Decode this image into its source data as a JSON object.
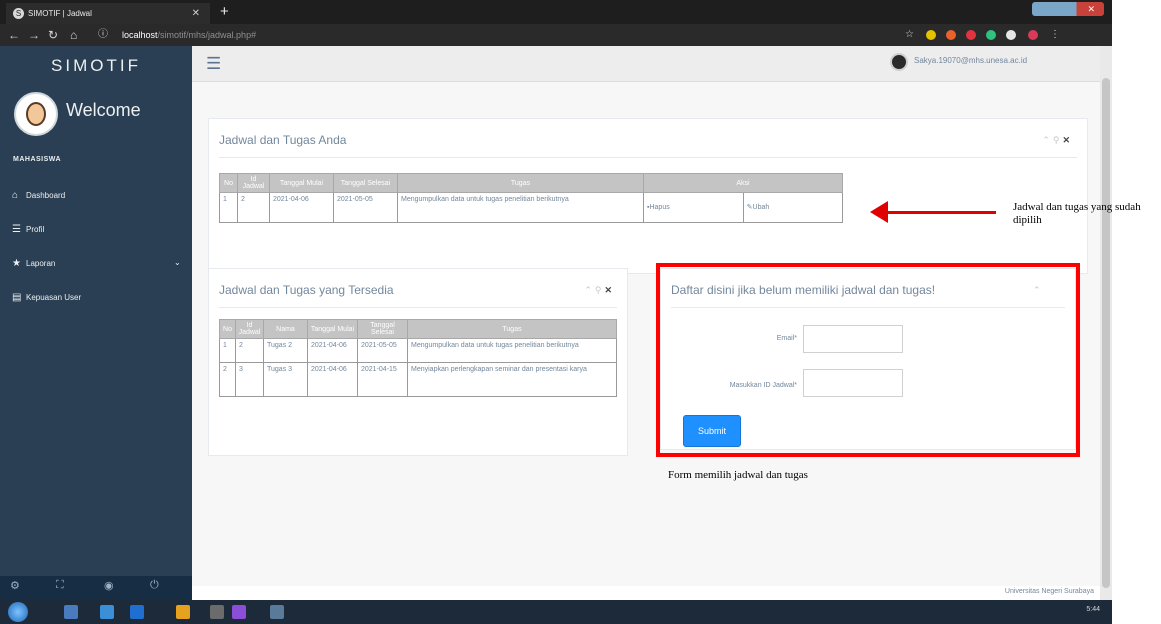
{
  "browser": {
    "tab_title": "SIMOTIF | Jadwal",
    "url_host": "localhost",
    "url_path": "/simotif/mhs/jadwal.php#"
  },
  "sidebar": {
    "brand": "SIMOTIF",
    "welcome": "Welcome",
    "username": "MAHASISWA",
    "items": [
      {
        "label": "Dashboard",
        "icon": "home-icon"
      },
      {
        "label": "Profil",
        "icon": "list-icon"
      },
      {
        "label": "Laporan",
        "icon": "star-icon"
      },
      {
        "label": "Kepuasan User",
        "icon": "table-icon"
      }
    ]
  },
  "topnav": {
    "user_email": "Sakya.19070@mhs.unesa.ac.id"
  },
  "panel_jadwal_anda": {
    "title": "Jadwal dan Tugas Anda",
    "headers": [
      "No",
      "Id Jadwal",
      "Tanggal Mulai",
      "Tanggal Selesai",
      "Tugas",
      "Aksi"
    ],
    "rows": [
      {
        "no": "1",
        "id": "2",
        "mulai": "2021-04-06",
        "selesai": "2021-05-05",
        "tugas": "Mengumpulkan data untuk tugas penelitian berikutnya",
        "hapus": "Hapus",
        "ubah": "Ubah"
      }
    ]
  },
  "panel_tersedia": {
    "title": "Jadwal dan Tugas yang Tersedia",
    "headers": [
      "No",
      "Id Jadwal",
      "Nama",
      "Tanggal Mulai",
      "Tanggal Selesai",
      "Tugas"
    ],
    "rows": [
      {
        "no": "1",
        "id": "2",
        "nama": "Tugas 2",
        "mulai": "2021-04-06",
        "selesai": "2021-05-05",
        "tugas": "Mengumpulkan data untuk tugas penelitian berikutnya"
      },
      {
        "no": "2",
        "id": "3",
        "nama": "Tugas 3",
        "mulai": "2021-04-06",
        "selesai": "2021-04-15",
        "tugas": "Menyiapkan perlengkapan seminar dan presentasi karya"
      }
    ]
  },
  "panel_form": {
    "title": "Daftar disini jika belum memiliki jadwal dan tugas!",
    "email_label": "Email*",
    "id_label": "Masukkan ID Jadwal*",
    "submit_label": "Submit"
  },
  "footer": {
    "text": "Universitas Negeri Surabaya"
  },
  "taskbar": {
    "time": "5:44"
  },
  "annotations": {
    "right_note": "Jadwal dan tugas yang sudah dipilih",
    "bottom_note": "Form memilih jadwal dan tugas",
    "highlight_color": "#ff0000"
  }
}
